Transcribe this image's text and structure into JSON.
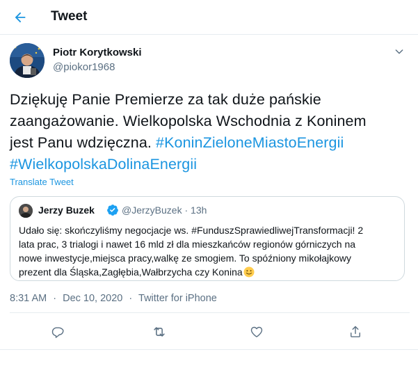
{
  "header": {
    "back_icon": "arrow-left-icon",
    "title": "Tweet"
  },
  "tweet": {
    "author_name": "Piotr Korytkowski",
    "author_handle": "@piokor1968",
    "text_lines": [
      "Dziękuję Panie Premierze za tak duże pańskie",
      "zaangażowanie. Wielkopolska Wschodnia z Koninem",
      "jest Panu wdzięczna. "
    ],
    "hashtag_1": "#KoninZieloneMiastoEnergii",
    "hashtag_2": "#WielkopolskaDolinaEnergii",
    "translate_label": "Translate Tweet",
    "time": "8:31 AM",
    "date": "Dec 10, 2020",
    "source": "Twitter for iPhone",
    "separator": "·"
  },
  "quoted": {
    "author_name": "Jerzy Buzek",
    "author_handle": "@JerzyBuzek",
    "separator": "·",
    "age": "13h",
    "verified_icon": "verified-badge-icon",
    "text_lines": [
      "Udało się: skończyliśmy negocjacje ws. #FunduszSprawiedliwejTransformacji! 2",
      "lata prac, 3 trialogi i nawet 16 mld zł dla mieszkańców regionów górniczych na",
      "nowe inwestycje,miejsca pracy,walkę ze smogiem. To spóźniony mikołajkowy",
      "prezent dla Śląska,Zagłębia,Wałbrzycha czy Konina"
    ],
    "emoji": "slightly-smiling-face-emoji"
  },
  "actions": {
    "reply_icon": "reply-icon",
    "retweet_icon": "retweet-icon",
    "like_icon": "heart-icon",
    "share_icon": "share-icon"
  },
  "colors": {
    "accent": "#1b95e0",
    "secondary_text": "#5b7083",
    "primary_text": "#0f1419",
    "border": "#e6ecf0"
  }
}
